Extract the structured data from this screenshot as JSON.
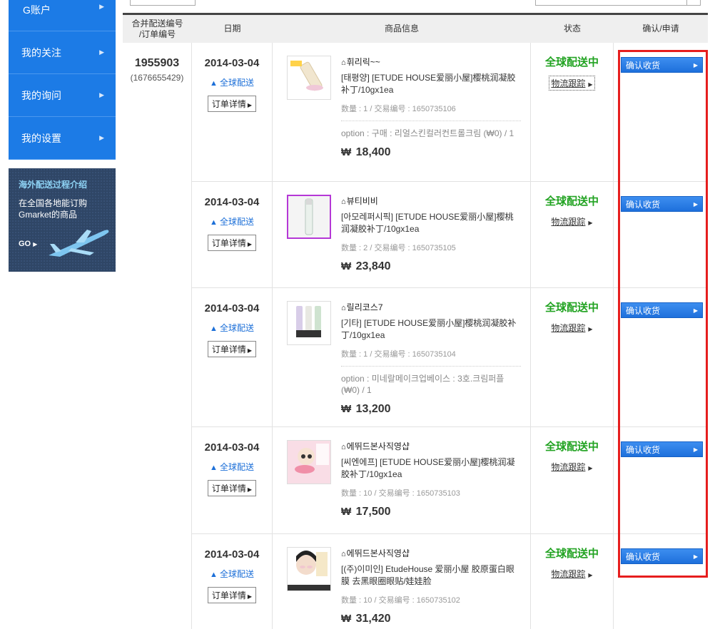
{
  "sidebar": {
    "items": [
      {
        "label": "G账户"
      },
      {
        "label": "我的关注"
      },
      {
        "label": "我的询问"
      },
      {
        "label": "我的设置"
      }
    ],
    "arrow_icon": "chevron-right-icon",
    "promo": {
      "title": "海外配送过程介绍",
      "line1": "在全国各地能订购",
      "line2": "Gmarket的商品",
      "go": "GO",
      "icon": "airplane-icon"
    }
  },
  "table": {
    "headers": {
      "order_no": "合并配送编号\n/订单编号",
      "date": "日期",
      "product": "商品信息",
      "status": "状态",
      "confirm": "确认/申请"
    },
    "order": {
      "combined_no": "1955903",
      "order_no": "(1676655429)"
    },
    "rows": [
      {
        "date": "2014-03-04",
        "shipping": "全球配送",
        "detail": "订单详情",
        "seller": "휘리릭~~",
        "product_name": "[태평양] [ETUDE HOUSE爱丽小屋]樱桃润凝胶补丁/10gx1ea",
        "meta": "数量 : 1 / 交易编号 : 1650735106",
        "option": "option : 구매 : 리얼스킨컬러컨트롤크림 (₩0) / 1",
        "price": "18,400",
        "status": "全球配送中",
        "track": "物流跟踪",
        "confirm": "确认收货"
      },
      {
        "date": "2014-03-04",
        "shipping": "全球配送",
        "detail": "订单详情",
        "seller": "뷰티비비",
        "product_name": "[아모레퍼시픽] [ETUDE HOUSE爱丽小屋]樱桃润凝胶补丁/10gx1ea",
        "meta": "数量 : 2 / 交易编号 : 1650735105",
        "option": "",
        "price": "23,840",
        "status": "全球配送中",
        "track": "物流跟踪",
        "confirm": "确认收货"
      },
      {
        "date": "2014-03-04",
        "shipping": "全球配送",
        "detail": "订单详情",
        "seller": "릴리코스7",
        "product_name": "[기타] [ETUDE HOUSE爱丽小屋]樱桃润凝胶补丁/10gx1ea",
        "meta": "数量 : 1 / 交易编号 : 1650735104",
        "option": "option : 미네랄메이크업베이스 : 3호.크림퍼플 (₩0) / 1",
        "price": "13,200",
        "status": "全球配送中",
        "track": "物流跟踪",
        "confirm": "确认收货"
      },
      {
        "date": "2014-03-04",
        "shipping": "全球配送",
        "detail": "订单详情",
        "seller": "에뛰드본사직영샵",
        "product_name": "[씨엔에프] [ETUDE HOUSE爱丽小屋]樱桃润凝胶补丁/10gx1ea",
        "meta": "数量 : 10 / 交易编号 : 1650735103",
        "option": "",
        "price": "17,500",
        "status": "全球配送中",
        "track": "物流跟踪",
        "confirm": "确认收货"
      },
      {
        "date": "2014-03-04",
        "shipping": "全球配送",
        "detail": "订单详情",
        "seller": "에뛰드본사직영샵",
        "product_name": "[(주)이미인] EtudeHouse 爱丽小屋 胶原蛋白眼膜 去黑眼圈眼贴/娃娃脸",
        "meta": "数量 : 10 / 交易编号 : 1650735102",
        "option": "",
        "price": "31,420",
        "status": "全球配送中",
        "track": "物流跟踪",
        "confirm": "确认收货"
      }
    ],
    "currency_symbol": "₩",
    "colors": {
      "status_green": "#22a322",
      "link_blue": "#1c6fd8",
      "button_blue": "#1e70dc",
      "highlight_red": "#e61e1e"
    }
  }
}
